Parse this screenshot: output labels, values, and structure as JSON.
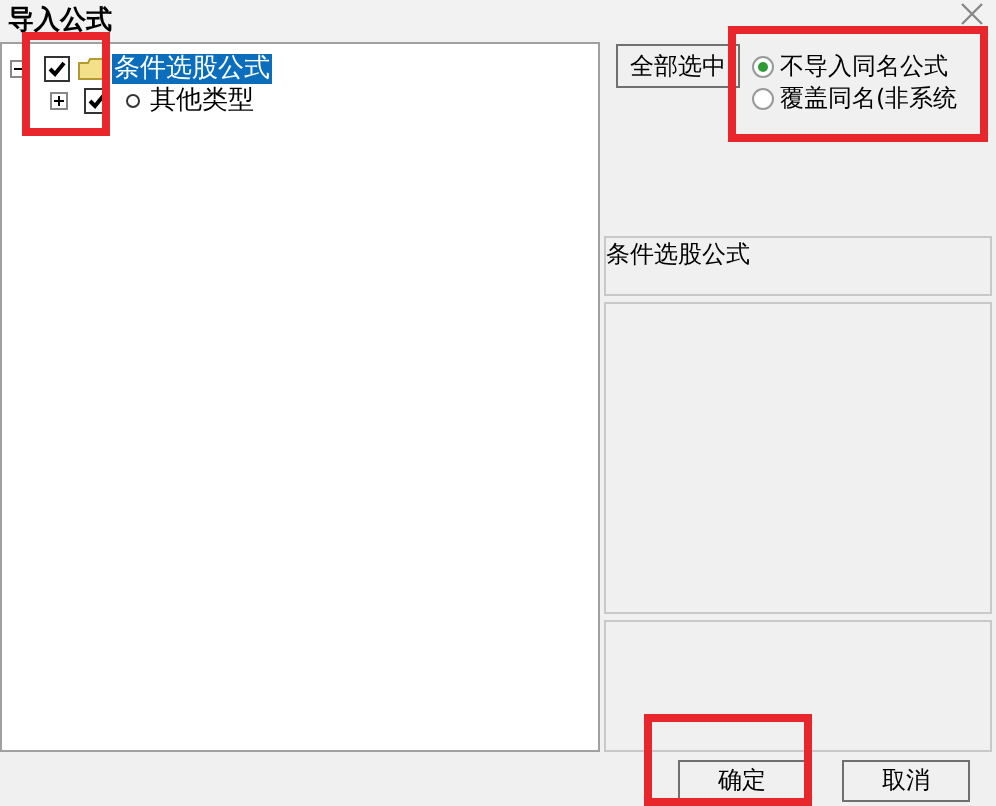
{
  "window": {
    "title": "导入公式"
  },
  "tree": [
    {
      "kind": "folder",
      "label": "条件选股公式",
      "checked": true,
      "expanded": true,
      "selected": true,
      "children": [
        {
          "kind": "item",
          "label": "其他类型",
          "checked": true,
          "expanded": false,
          "selected": false
        }
      ]
    }
  ],
  "select_all_button": "全部选中",
  "import_options": [
    {
      "label": "不导入同名公式",
      "selected": true
    },
    {
      "label": "覆盖同名(非系统",
      "selected": false
    }
  ],
  "preview": {
    "title": "条件选股公式"
  },
  "buttons": [
    "确定",
    "取消"
  ]
}
